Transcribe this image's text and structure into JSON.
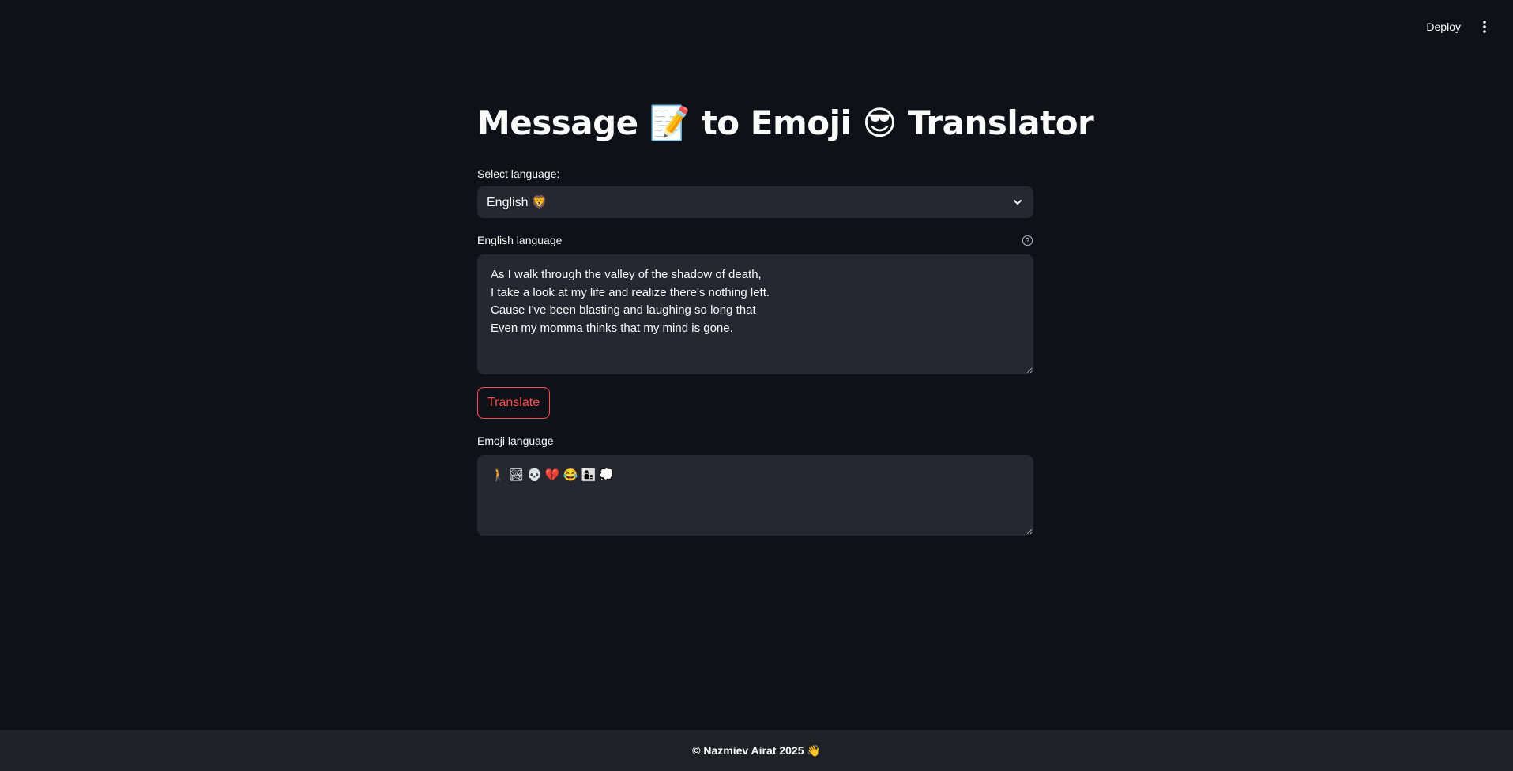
{
  "toolbar": {
    "deploy_label": "Deploy",
    "menu_icon": "kebab-menu-icon"
  },
  "main": {
    "title": "Message 📝 to Emoji 😎 Translator",
    "select_language": {
      "label": "Select language:",
      "selected": "English 🦁"
    },
    "input": {
      "label": "English language",
      "help_icon": "help-circle-icon",
      "value": "As I walk through the valley of the shadow of death,\nI take a look at my life and realize there's nothing left.\nCause I've been blasting and laughing so long that\nEven my momma thinks that my mind is gone."
    },
    "translate_button": "Translate",
    "output": {
      "label": "Emoji language",
      "value": "🚶 🏞 💀 💔 😂 👩‍👦 💭"
    }
  },
  "footer": {
    "text": "© Nazmiev Airat 2025 👋"
  },
  "colors": {
    "background": "#0e1117",
    "input_bg": "#262730",
    "accent": "#ff4b4b",
    "footer_bg": "#1e2126",
    "text": "#fafafa"
  }
}
